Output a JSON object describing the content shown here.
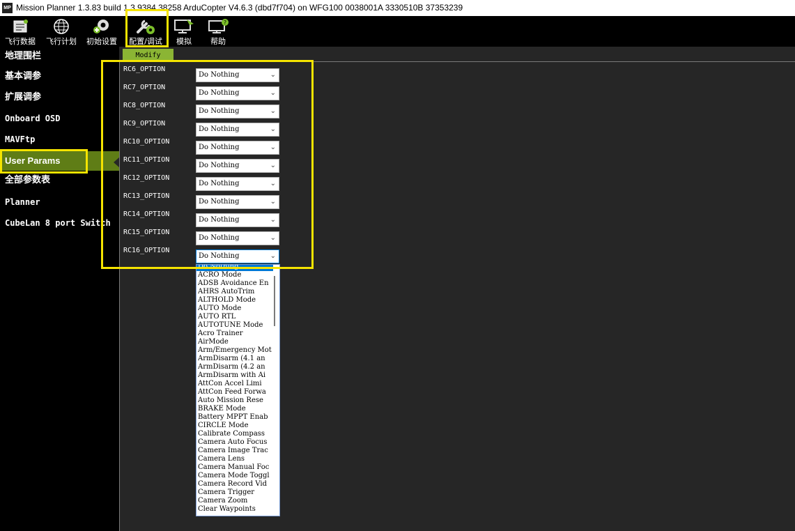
{
  "window": {
    "title": "Mission Planner 1.3.83 build 1.3.9384.38258 ArduCopter V4.6.3 (dbd7f704) on WFG100 0038001A 3330510B 37353239",
    "app_icon": "MP"
  },
  "toolbar": {
    "buttons": [
      {
        "label": "飞行数据",
        "icon": "flight-data-icon"
      },
      {
        "label": "飞行计划",
        "icon": "flight-plan-icon"
      },
      {
        "label": "初始设置",
        "icon": "initial-setup-icon"
      },
      {
        "label": "配置/调试",
        "icon": "config-tuning-icon"
      },
      {
        "label": "模拟",
        "icon": "simulation-icon"
      },
      {
        "label": "帮助",
        "icon": "help-icon"
      }
    ],
    "active_index": 3
  },
  "sidebar": {
    "items": [
      {
        "label": "地理围栏"
      },
      {
        "label": "基本调参"
      },
      {
        "label": "扩展调参"
      },
      {
        "label": "Onboard OSD"
      },
      {
        "label": "MAVFtp"
      },
      {
        "label": "User Params"
      },
      {
        "label": "全部参数表"
      },
      {
        "label": "Planner"
      },
      {
        "label": "CubeLan 8 port Switch"
      }
    ],
    "active_index": 5
  },
  "content": {
    "tab_label": "Modify",
    "params": [
      {
        "name": "RC6_OPTION",
        "value": "Do Nothing"
      },
      {
        "name": "RC7_OPTION",
        "value": "Do Nothing"
      },
      {
        "name": "RC8_OPTION",
        "value": "Do Nothing"
      },
      {
        "name": "RC9_OPTION",
        "value": "Do Nothing"
      },
      {
        "name": "RC10_OPTION",
        "value": "Do Nothing"
      },
      {
        "name": "RC11_OPTION",
        "value": "Do Nothing"
      },
      {
        "name": "RC12_OPTION",
        "value": "Do Nothing"
      },
      {
        "name": "RC13_OPTION",
        "value": "Do Nothing"
      },
      {
        "name": "RC14_OPTION",
        "value": "Do Nothing"
      },
      {
        "name": "RC15_OPTION",
        "value": "Do Nothing"
      },
      {
        "name": "RC16_OPTION",
        "value": "Do Nothing"
      }
    ],
    "dropdown_options": [
      "Do Nothing",
      "ACRO Mode",
      "ADSB Avoidance En",
      "AHRS AutoTrim",
      "ALTHOLD Mode",
      "AUTO Mode",
      "AUTO RTL",
      "AUTOTUNE Mode",
      "Acro Trainer",
      "AirMode",
      "Arm/Emergency Mot",
      "ArmDisarm (4.1 an",
      "ArmDisarm (4.2 an",
      "ArmDisarm with Ai",
      "AttCon Accel Limi",
      "AttCon Feed Forwa",
      "Auto Mission Rese",
      "BRAKE Mode",
      "Battery MPPT Enab",
      "CIRCLE Mode",
      "Calibrate Compass",
      "Camera Auto Focus",
      "Camera Image Trac",
      "Camera Lens",
      "Camera Manual Foc",
      "Camera Mode Toggl",
      "Camera Record Vid",
      "Camera Trigger",
      "Camera Zoom",
      "Clear Waypoints"
    ],
    "dropdown_selected_index": 0
  },
  "colors": {
    "highlight": "#f5e400",
    "active_green": "#5f7d16",
    "tab_green": "#8bb534",
    "selection_blue": "#0078d7"
  }
}
